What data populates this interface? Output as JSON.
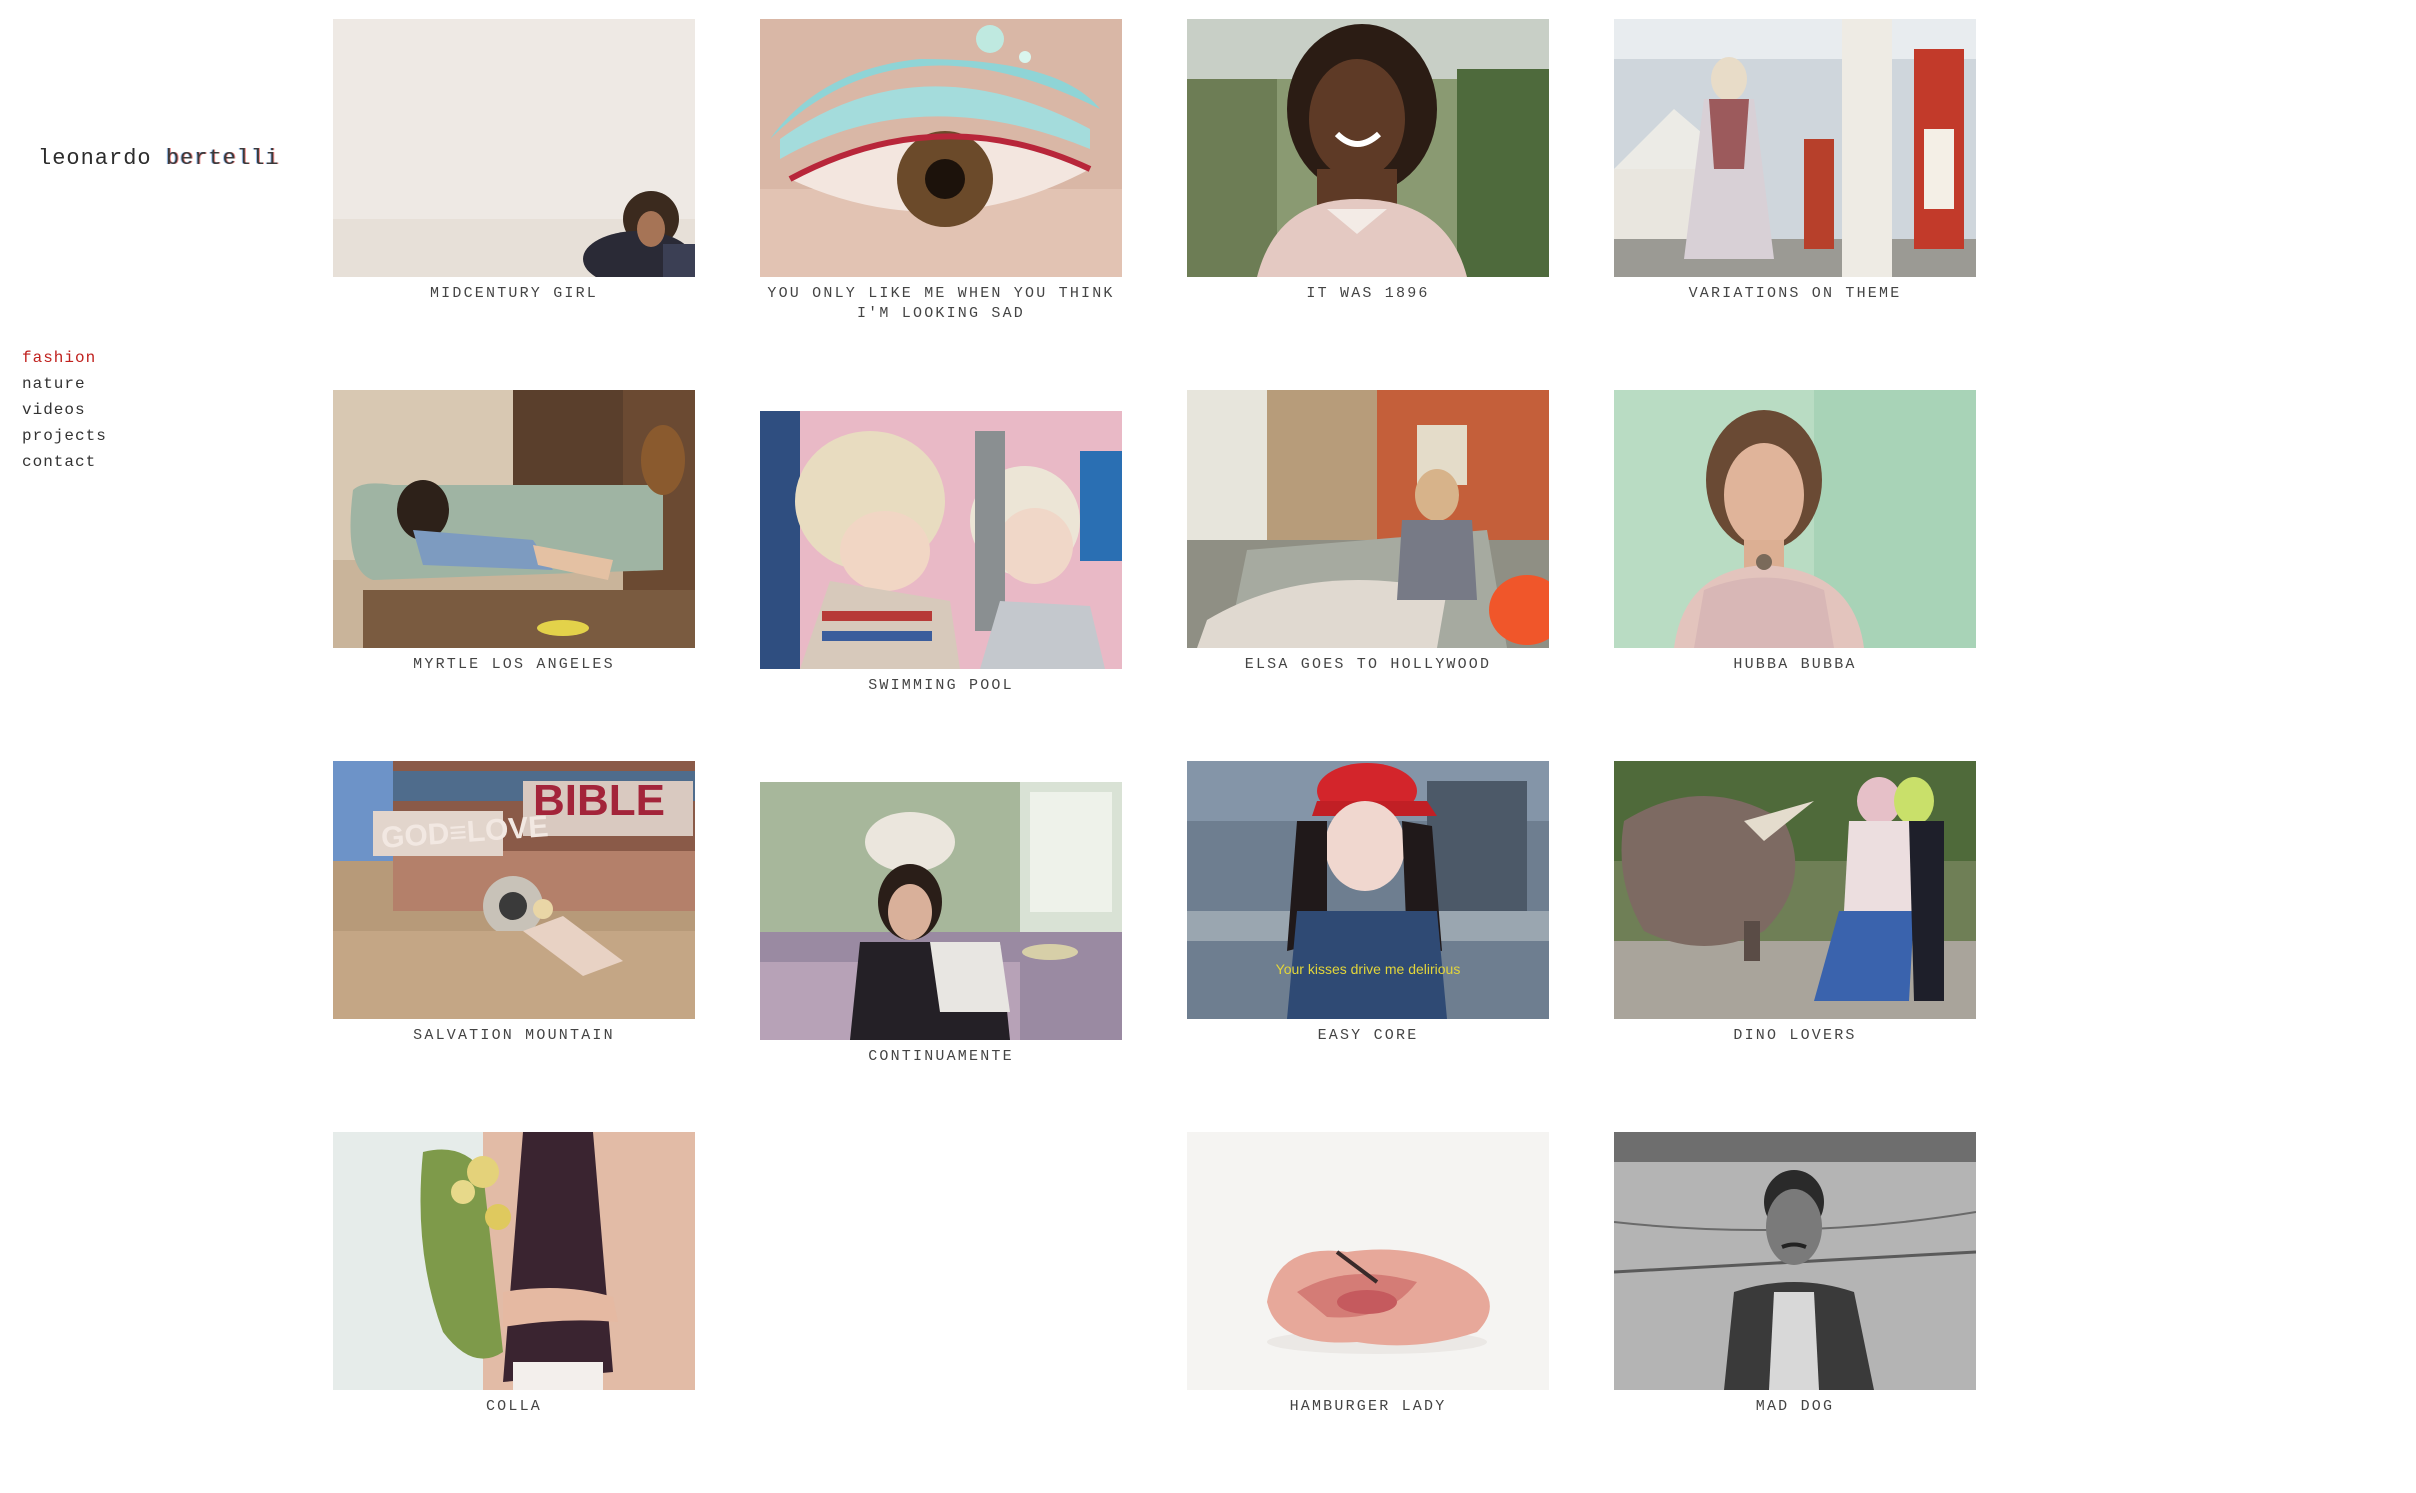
{
  "site": {
    "logo_first": "leonardo",
    "logo_last": "bertelli"
  },
  "nav": {
    "items": [
      {
        "label": "fashion",
        "active": true
      },
      {
        "label": "nature",
        "active": false
      },
      {
        "label": "videos",
        "active": false
      },
      {
        "label": "projects",
        "active": false
      },
      {
        "label": "contact",
        "active": false
      }
    ]
  },
  "colors": {
    "accent": "#c0211e",
    "text": "#444444",
    "background": "#ffffff"
  },
  "gallery": {
    "items": [
      {
        "title": "MIDCENTURY GIRL",
        "icon": "photo-portrait-sepia"
      },
      {
        "title": "YOU ONLY LIKE ME WHEN YOU THINK I'M LOOKING SAD",
        "icon": "photo-eye-glitter"
      },
      {
        "title": "IT WAS 1896",
        "icon": "photo-smiling-portrait"
      },
      {
        "title": "VARIATIONS ON THEME",
        "icon": "photo-gas-station"
      },
      {
        "title": "MYRTLE LOS ANGELES",
        "icon": "photo-sofa-room"
      },
      {
        "title": "SWIMMING POOL",
        "icon": "photo-two-girls-pink"
      },
      {
        "title": "ELSA GOES TO HOLLYWOOD",
        "icon": "photo-trailer-interior"
      },
      {
        "title": "HUBBA BUBBA",
        "icon": "photo-green-portrait"
      },
      {
        "title": "SALVATION MOUNTAIN",
        "icon": "photo-bible-truck"
      },
      {
        "title": "CONTINUAMENTE",
        "icon": "photo-bathroom-girl"
      },
      {
        "title": "EASY CORE",
        "icon": "photo-red-cap"
      },
      {
        "title": "DINO LOVERS",
        "icon": "photo-dinosaur"
      },
      {
        "title": "COLLA",
        "icon": "photo-flowers-torso"
      },
      {
        "title": "HAMBURGER LADY",
        "icon": "photo-meat"
      },
      {
        "title": "MAD DOG",
        "icon": "photo-bw-portrait"
      }
    ],
    "easy_core_subtitle": "Your kisses drive me delirious"
  }
}
